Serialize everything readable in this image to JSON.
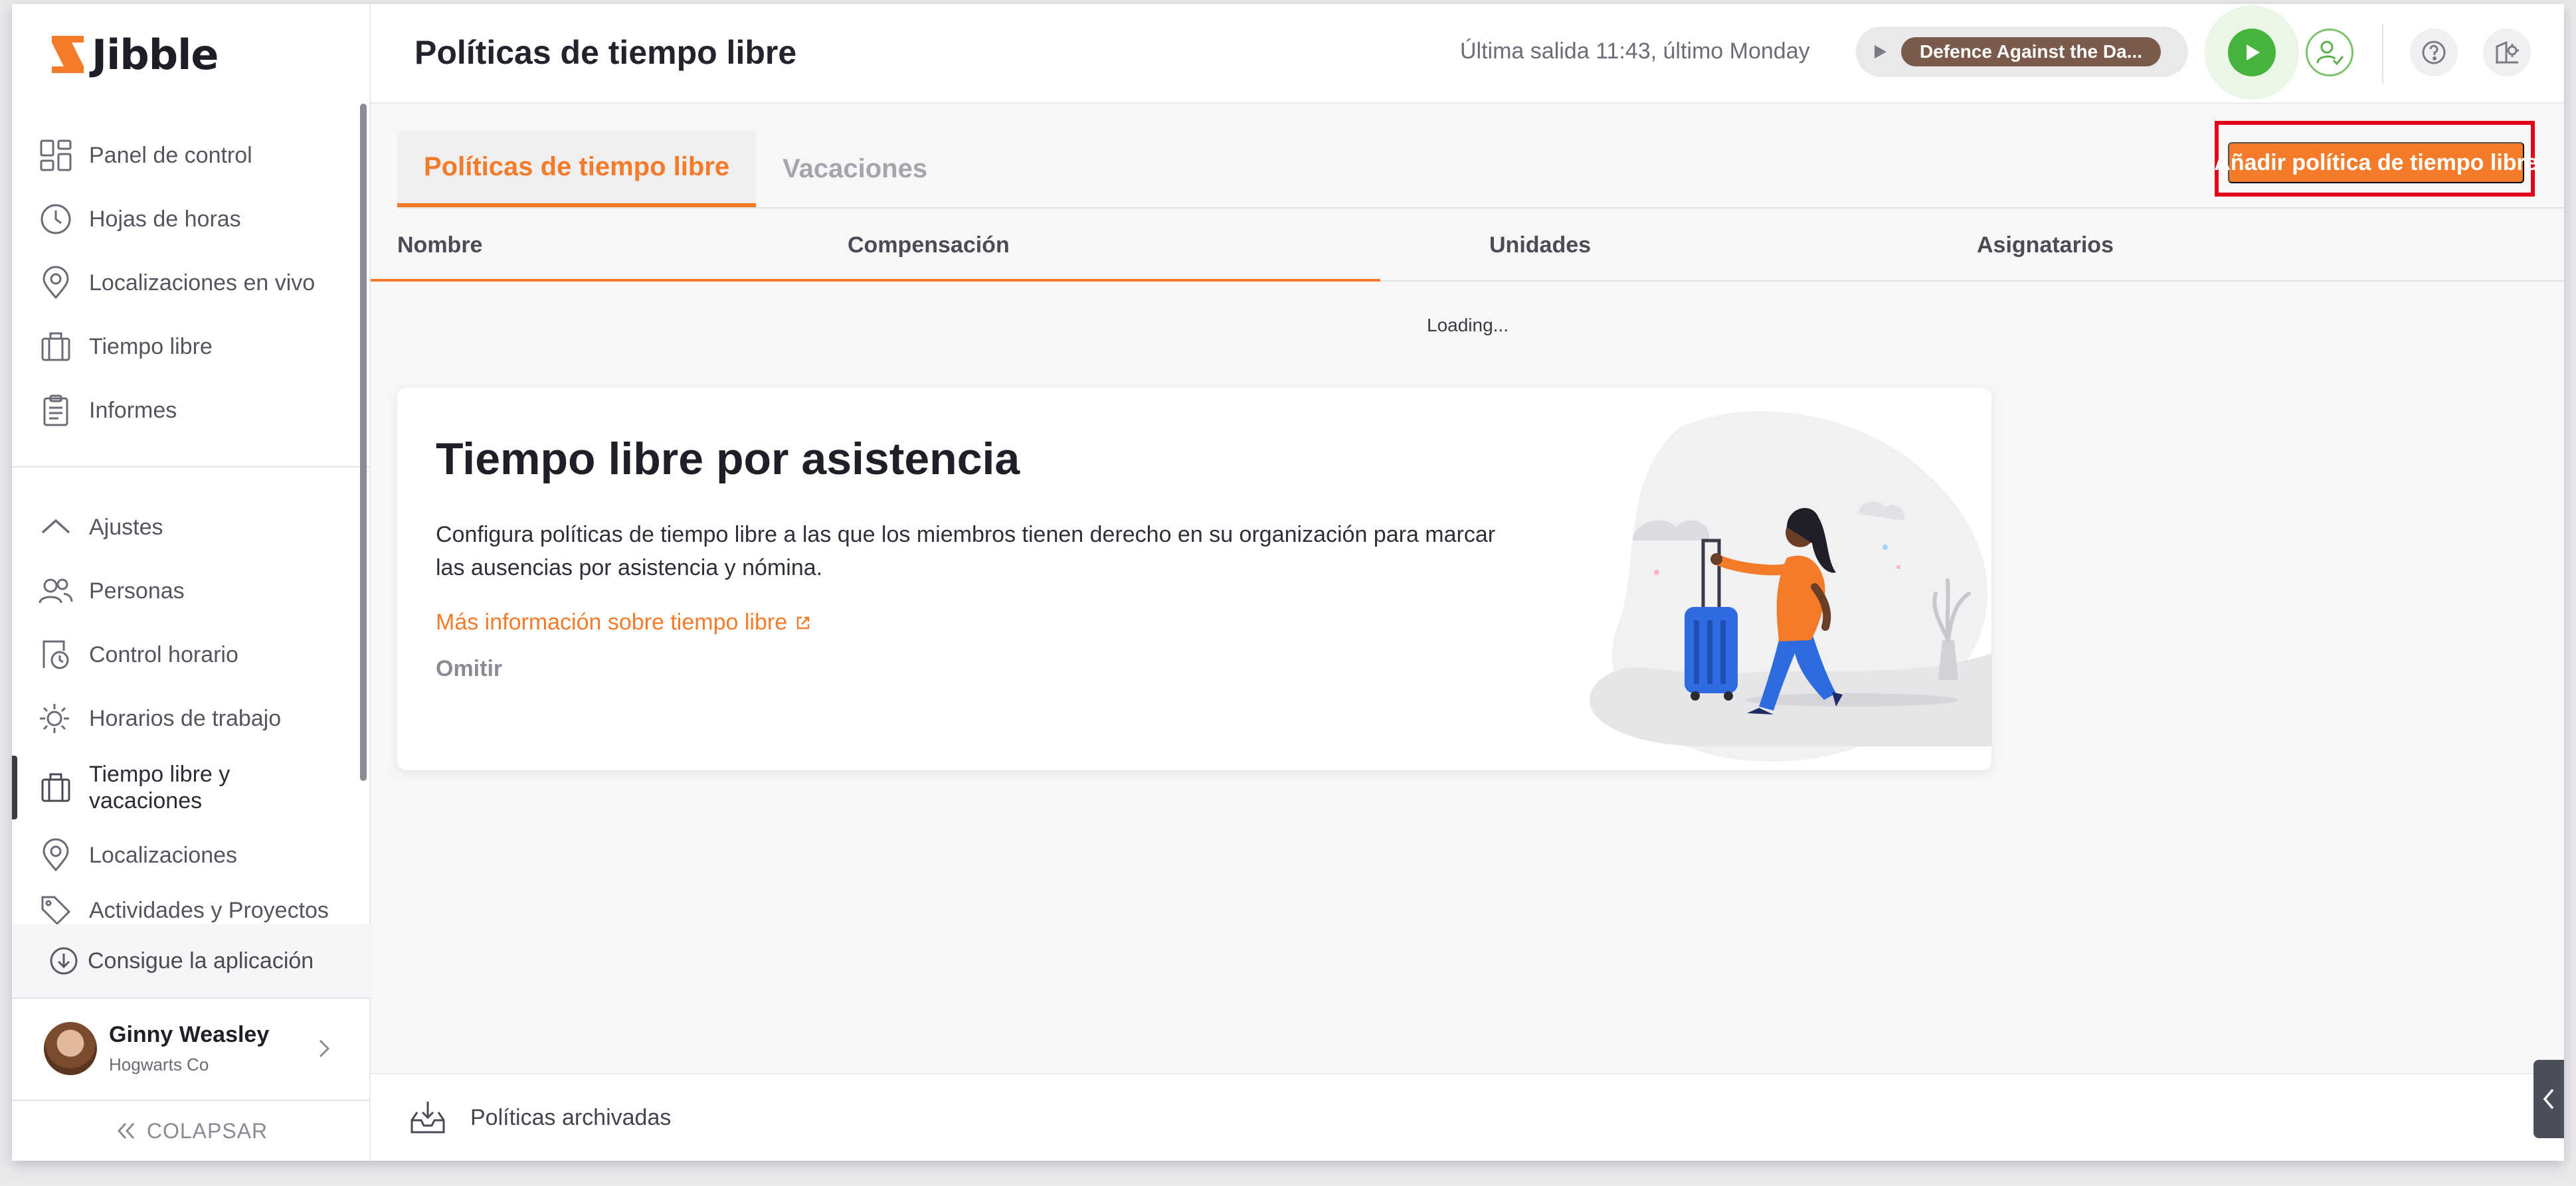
{
  "app": {
    "name": "Jibble",
    "brand_color": "#f47b2a"
  },
  "sidebar": {
    "items": [
      {
        "label": "Panel de control",
        "icon": "dashboard-icon"
      },
      {
        "label": "Hojas de horas",
        "icon": "clock-icon"
      },
      {
        "label": "Localizaciones en vivo",
        "icon": "location-pin-icon"
      },
      {
        "label": "Tiempo libre",
        "icon": "suitcase-icon"
      },
      {
        "label": "Informes",
        "icon": "clipboard-icon"
      }
    ],
    "settings_items": [
      {
        "label": "Ajustes",
        "icon": "chevron-up-icon"
      },
      {
        "label": "Personas",
        "icon": "people-icon"
      },
      {
        "label": "Control horario",
        "icon": "time-tracking-icon"
      },
      {
        "label": "Horarios de trabajo",
        "icon": "sun-schedule-icon"
      },
      {
        "label": "Tiempo libre y vacaciones",
        "icon": "suitcase-icon",
        "active": true
      },
      {
        "label": "Localizaciones",
        "icon": "location-pin-icon"
      },
      {
        "label": "Actividades y Proyectos",
        "icon": "tag-icon"
      }
    ],
    "get_app": "Consigue la aplicación",
    "profile": {
      "name": "Ginny Weasley",
      "org": "Hogwarts Co"
    },
    "collapse": "COLAPSAR"
  },
  "header": {
    "title": "Políticas de tiempo libre",
    "last_out": "Última salida 11:43, último Monday",
    "tracker_activity": "Defence Against the Da..."
  },
  "main": {
    "tabs": [
      {
        "label": "Políticas de tiempo libre",
        "active": true
      },
      {
        "label": "Vacaciones",
        "active": false
      }
    ],
    "add_button": "Añadir política de tiempo libre",
    "table": {
      "columns": [
        "Nombre",
        "Compensación",
        "Unidades",
        "Asignatarios"
      ],
      "status": "Loading..."
    },
    "card": {
      "title": "Tiempo libre por asistencia",
      "text": "Configura políticas de tiempo libre a las que los miembros tienen derecho en su organización para marcar las ausencias por asistencia y nómina.",
      "link": "Más información sobre tiempo libre",
      "skip": "Omitir"
    },
    "footer": "Políticas archivadas"
  }
}
